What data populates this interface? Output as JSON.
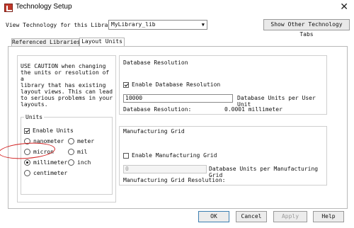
{
  "window": {
    "title": "Technology Setup",
    "close_icon": "close-icon"
  },
  "view_row": {
    "label": "View Technology for this Library:",
    "library_value": "MyLibrary_lib",
    "show_button": "Show Other Technology Tabs"
  },
  "tabs": [
    {
      "label": "Referenced Libraries",
      "active": false
    },
    {
      "label": "Layout Units",
      "active": true
    }
  ],
  "caution": {
    "text": "USE CAUTION when changing\nthe units or resolution of a\nlibrary that has existing\nlayout views. This can lead\nto serious problems in your\nlayouts."
  },
  "units": {
    "title": "Units",
    "enable_label": "Enable Units",
    "enable_checked": true,
    "options": [
      {
        "label": "nanometer",
        "checked": false
      },
      {
        "label": "meter",
        "checked": false
      },
      {
        "label": "micron",
        "checked": false
      },
      {
        "label": "mil",
        "checked": false
      },
      {
        "label": "millimeter",
        "checked": true
      },
      {
        "label": "inch",
        "checked": false
      },
      {
        "label": "centimeter",
        "checked": false
      }
    ],
    "highlight_color": "#d32020"
  },
  "database_resolution": {
    "title": "Database Resolution",
    "enable_label": "Enable Database Resolution",
    "enable_checked": true,
    "input_value": "10000",
    "units_label": "Database Units per User Unit",
    "resolution_label": "Database Resolution:",
    "resolution_value": "0.0001 millimeter"
  },
  "manufacturing_grid": {
    "title": "Manufacturing Grid",
    "enable_label": "Enable Manufacturing Grid",
    "enable_checked": false,
    "input_value": "0",
    "units_label": "Database Units per Manufacturing Grid",
    "resolution_label": "Manufacturing Grid Resolution:"
  },
  "buttons": {
    "ok": "OK",
    "cancel": "Cancel",
    "apply": "Apply",
    "help": "Help"
  },
  "colors": {
    "app_icon": "#c0392b",
    "default_button_border": "#3c7fb1"
  }
}
